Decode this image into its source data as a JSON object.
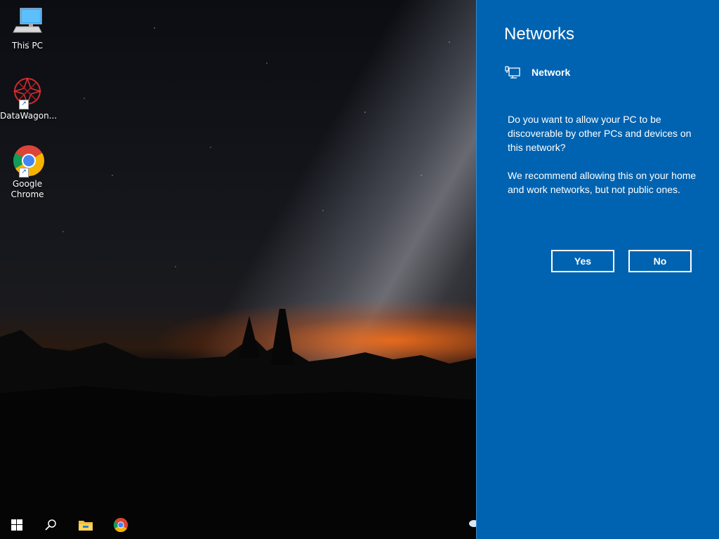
{
  "desktop": {
    "icons": [
      {
        "label": "This PC",
        "icon": "computer-icon"
      },
      {
        "label": "DataWagon...",
        "icon": "datawagon-app-icon"
      },
      {
        "label": "Google Chrome",
        "icon": "chrome-icon"
      }
    ]
  },
  "taskbar": {
    "items": [
      {
        "icon": "windows-start-icon"
      },
      {
        "icon": "search-icon"
      },
      {
        "icon": "file-explorer-icon"
      },
      {
        "icon": "chrome-icon"
      }
    ],
    "tray_icon": "onedrive-cloud-icon"
  },
  "networks_panel": {
    "title": "Networks",
    "network_name": "Network",
    "network_icon": "ethernet-icon",
    "prompt": "Do you want to allow your PC to be discoverable by other PCs and devices on this network?",
    "recommendation": "We recommend allowing this on your home and work networks, but not public ones.",
    "yes_label": "Yes",
    "no_label": "No"
  },
  "colors": {
    "panel_background": "#0063b1",
    "text": "#ffffff",
    "taskbar": "#050505"
  }
}
